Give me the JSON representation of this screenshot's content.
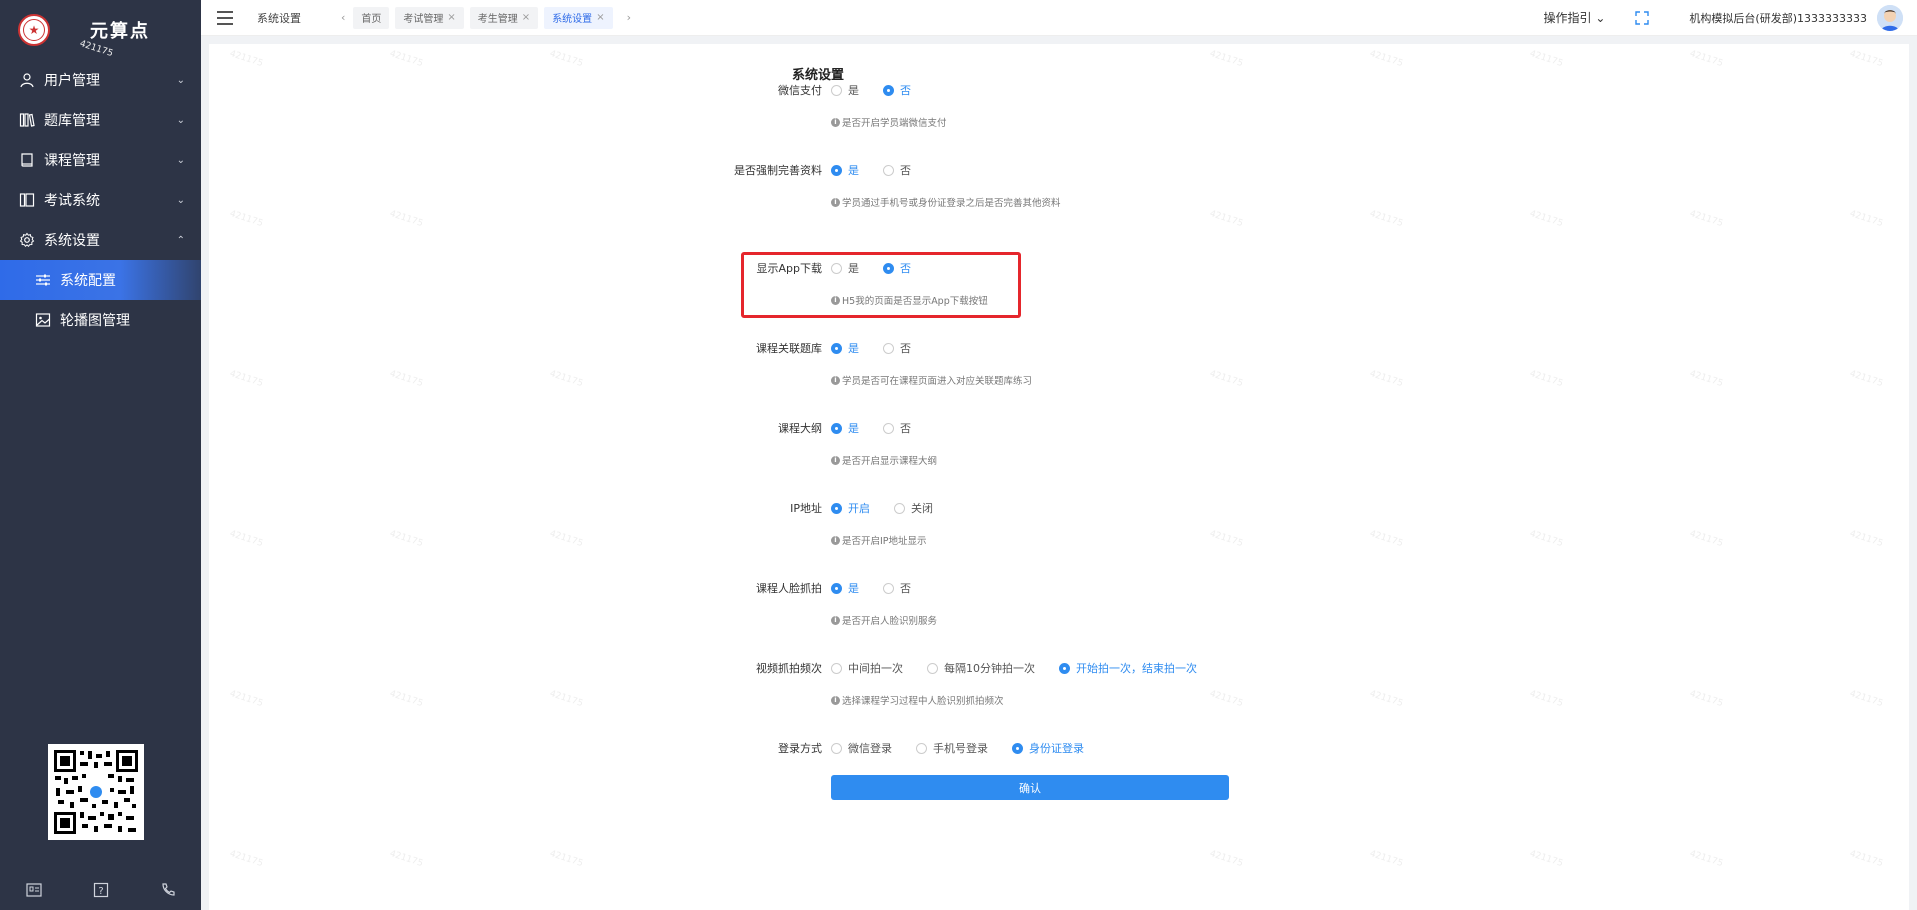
{
  "app": {
    "name": "元算点"
  },
  "sidebar": {
    "items": [
      {
        "label": "用户管理",
        "icon": "user-icon",
        "expanded": false
      },
      {
        "label": "题库管理",
        "icon": "library-icon",
        "expanded": false
      },
      {
        "label": "课程管理",
        "icon": "book-icon",
        "expanded": false
      },
      {
        "label": "考试系统",
        "icon": "exam-icon",
        "expanded": false
      },
      {
        "label": "系统设置",
        "icon": "gear-icon",
        "expanded": true
      }
    ],
    "subitems": [
      {
        "label": "系统配置",
        "icon": "sliders-icon",
        "active": true
      },
      {
        "label": "轮播图管理",
        "icon": "image-icon",
        "active": false
      }
    ]
  },
  "header": {
    "breadcrumb": "系统设置",
    "tabs": [
      {
        "label": "首页",
        "closable": false,
        "active": false
      },
      {
        "label": "考试管理",
        "closable": true,
        "active": false
      },
      {
        "label": "考生管理",
        "closable": true,
        "active": false
      },
      {
        "label": "系统设置",
        "closable": true,
        "active": true
      }
    ],
    "guide": "操作指引",
    "user": "机构模拟后台(研发部)1333333333"
  },
  "page": {
    "title": "系统设置",
    "fields": [
      {
        "label": "微信支付",
        "options": [
          "是",
          "否"
        ],
        "selected": 1,
        "hint": "是否开启学员端微信支付"
      },
      {
        "label": "是否强制完善资料",
        "options": [
          "是",
          "否"
        ],
        "selected": 0,
        "hint": "学员通过手机号或身份证登录之后是否完善其他资料"
      },
      {
        "label": "显示App下载",
        "options": [
          "是",
          "否"
        ],
        "selected": 1,
        "hint": "H5我的页面是否显示App下载按钮"
      },
      {
        "label": "课程关联题库",
        "options": [
          "是",
          "否"
        ],
        "selected": 0,
        "hint": "学员是否可在课程页面进入对应关联题库练习"
      },
      {
        "label": "课程大纲",
        "options": [
          "是",
          "否"
        ],
        "selected": 0,
        "hint": "是否开启显示课程大纲"
      },
      {
        "label": "IP地址",
        "options": [
          "开启",
          "关闭"
        ],
        "selected": 0,
        "hint": "是否开启IP地址显示"
      },
      {
        "label": "课程人脸抓拍",
        "options": [
          "是",
          "否"
        ],
        "selected": 0,
        "hint": "是否开启人脸识别服务"
      },
      {
        "label": "视频抓拍频次",
        "options": [
          "中间拍一次",
          "每隔10分钟拍一次",
          "开始拍一次，结束拍一次"
        ],
        "selected": 2,
        "hint": "选择课程学习过程中人脸识别抓拍频次"
      },
      {
        "label": "登录方式",
        "options": [
          "微信登录",
          "手机号登录",
          "身份证登录"
        ],
        "selected": 2,
        "hint": ""
      }
    ],
    "confirm_label": "确认"
  },
  "watermark": "421175",
  "colors": {
    "sidebar_bg": "#2d3446",
    "accent": "#2f8cf0",
    "highlight_border": "#e5262c"
  }
}
